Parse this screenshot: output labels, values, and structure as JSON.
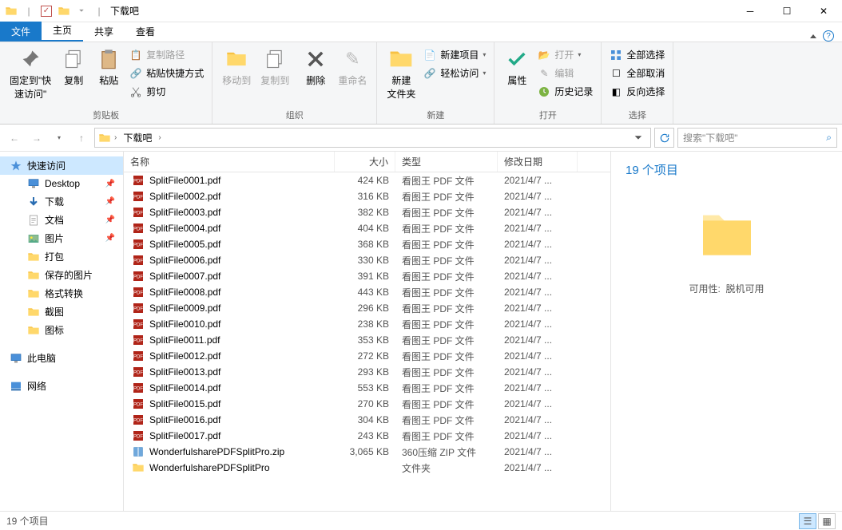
{
  "window": {
    "title": "下载吧"
  },
  "tabs": {
    "file": "文件",
    "home": "主页",
    "share": "共享",
    "view": "查看"
  },
  "ribbon": {
    "clipboard": {
      "label": "剪贴板",
      "pin": "固定到\"快\n速访问\"",
      "copy": "复制",
      "paste": "粘贴",
      "copy_path": "复制路径",
      "paste_shortcut": "粘贴快捷方式",
      "cut": "剪切"
    },
    "organize": {
      "label": "组织",
      "move_to": "移动到",
      "copy_to": "复制到",
      "delete": "删除",
      "rename": "重命名"
    },
    "new": {
      "label": "新建",
      "new_folder": "新建\n文件夹",
      "new_item": "新建项目",
      "easy_access": "轻松访问"
    },
    "open": {
      "label": "打开",
      "properties": "属性",
      "open": "打开",
      "edit": "编辑",
      "history": "历史记录"
    },
    "select": {
      "label": "选择",
      "select_all": "全部选择",
      "select_none": "全部取消",
      "invert": "反向选择"
    }
  },
  "nav": {
    "crumb": "下载吧",
    "search_placeholder": "搜索\"下载吧\""
  },
  "sidebar": {
    "quick_access": "快速访问",
    "desktop": "Desktop",
    "downloads": "下载",
    "documents": "文档",
    "pictures": "图片",
    "items": [
      "打包",
      "保存的图片",
      "格式转换",
      "截图",
      "图标"
    ],
    "this_pc": "此电脑",
    "network": "网络"
  },
  "columns": {
    "name": "名称",
    "size": "大小",
    "type": "类型",
    "date": "修改日期"
  },
  "files": [
    {
      "name": "SplitFile0001.pdf",
      "size": "424 KB",
      "type": "看图王 PDF 文件",
      "date": "2021/4/7 ...",
      "kind": "pdf"
    },
    {
      "name": "SplitFile0002.pdf",
      "size": "316 KB",
      "type": "看图王 PDF 文件",
      "date": "2021/4/7 ...",
      "kind": "pdf"
    },
    {
      "name": "SplitFile0003.pdf",
      "size": "382 KB",
      "type": "看图王 PDF 文件",
      "date": "2021/4/7 ...",
      "kind": "pdf"
    },
    {
      "name": "SplitFile0004.pdf",
      "size": "404 KB",
      "type": "看图王 PDF 文件",
      "date": "2021/4/7 ...",
      "kind": "pdf"
    },
    {
      "name": "SplitFile0005.pdf",
      "size": "368 KB",
      "type": "看图王 PDF 文件",
      "date": "2021/4/7 ...",
      "kind": "pdf"
    },
    {
      "name": "SplitFile0006.pdf",
      "size": "330 KB",
      "type": "看图王 PDF 文件",
      "date": "2021/4/7 ...",
      "kind": "pdf"
    },
    {
      "name": "SplitFile0007.pdf",
      "size": "391 KB",
      "type": "看图王 PDF 文件",
      "date": "2021/4/7 ...",
      "kind": "pdf"
    },
    {
      "name": "SplitFile0008.pdf",
      "size": "443 KB",
      "type": "看图王 PDF 文件",
      "date": "2021/4/7 ...",
      "kind": "pdf"
    },
    {
      "name": "SplitFile0009.pdf",
      "size": "296 KB",
      "type": "看图王 PDF 文件",
      "date": "2021/4/7 ...",
      "kind": "pdf"
    },
    {
      "name": "SplitFile0010.pdf",
      "size": "238 KB",
      "type": "看图王 PDF 文件",
      "date": "2021/4/7 ...",
      "kind": "pdf"
    },
    {
      "name": "SplitFile0011.pdf",
      "size": "353 KB",
      "type": "看图王 PDF 文件",
      "date": "2021/4/7 ...",
      "kind": "pdf"
    },
    {
      "name": "SplitFile0012.pdf",
      "size": "272 KB",
      "type": "看图王 PDF 文件",
      "date": "2021/4/7 ...",
      "kind": "pdf"
    },
    {
      "name": "SplitFile0013.pdf",
      "size": "293 KB",
      "type": "看图王 PDF 文件",
      "date": "2021/4/7 ...",
      "kind": "pdf"
    },
    {
      "name": "SplitFile0014.pdf",
      "size": "553 KB",
      "type": "看图王 PDF 文件",
      "date": "2021/4/7 ...",
      "kind": "pdf"
    },
    {
      "name": "SplitFile0015.pdf",
      "size": "270 KB",
      "type": "看图王 PDF 文件",
      "date": "2021/4/7 ...",
      "kind": "pdf"
    },
    {
      "name": "SplitFile0016.pdf",
      "size": "304 KB",
      "type": "看图王 PDF 文件",
      "date": "2021/4/7 ...",
      "kind": "pdf"
    },
    {
      "name": "SplitFile0017.pdf",
      "size": "243 KB",
      "type": "看图王 PDF 文件",
      "date": "2021/4/7 ...",
      "kind": "pdf"
    },
    {
      "name": "WonderfulsharePDFSplitPro.zip",
      "size": "3,065 KB",
      "type": "360压缩 ZIP 文件",
      "date": "2021/4/7 ...",
      "kind": "zip"
    },
    {
      "name": "WonderfulsharePDFSplitPro",
      "size": "",
      "type": "文件夹",
      "date": "2021/4/7 ...",
      "kind": "folder"
    }
  ],
  "preview": {
    "title": "19 个项目",
    "availability_label": "可用性:",
    "availability_value": "脱机可用"
  },
  "status": {
    "items": "19 个项目"
  }
}
